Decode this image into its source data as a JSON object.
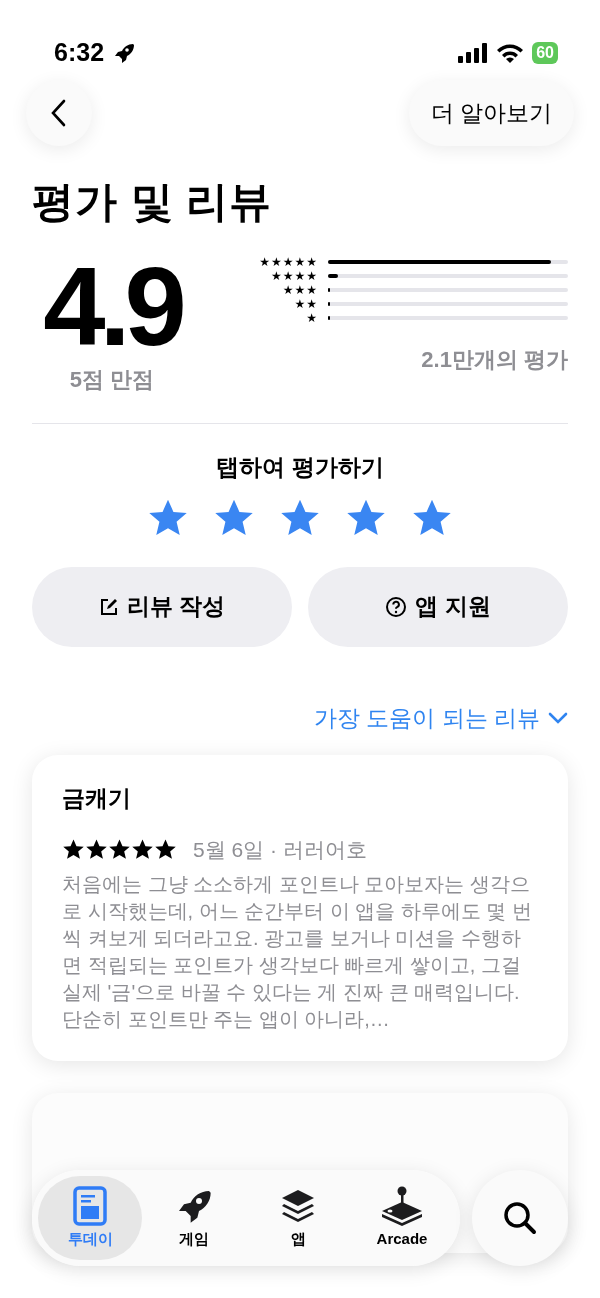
{
  "status_bar": {
    "time": "6:32",
    "battery": "60"
  },
  "header": {
    "more_button": "더 알아보기"
  },
  "title": "평가 및 리뷰",
  "summary": {
    "score": "4.9",
    "out_of": "5점 만점",
    "count": "2.1만개의 평가",
    "histogram": [
      {
        "label": "★★★★★",
        "level": 0.93
      },
      {
        "label": "★★★★",
        "level": 0.04
      },
      {
        "label": "★★★",
        "level": 0.01
      },
      {
        "label": "★★",
        "level": 0.005
      },
      {
        "label": "★",
        "level": 0.005
      }
    ]
  },
  "tap_to_rate": {
    "label": "탭하여 평가하기",
    "stars": 5
  },
  "actions": [
    {
      "label": "리뷰 작성",
      "kind": "write"
    },
    {
      "label": "앱 지원",
      "kind": "support"
    }
  ],
  "sort": {
    "label": "가장 도움이 되는 리뷰"
  },
  "reviews": [
    {
      "title": "금캐기",
      "stars": 5,
      "meta": "5월 6일 · 러러어호",
      "body": "처음에는 그냥 소소하게 포인트나 모아보자는 생각으로 시작했는데, 어느 순간부터 이 앱을 하루에도 몇 번씩 켜보게 되더라고요. 광고를 보거나 미션을 수행하면 적립되는 포인트가 생각보다 빠르게 쌓이고, 그걸 실제 '금'으로 바꿀 수 있다는 게 진짜 큰 매력입니다. 단순히 포인트만 주는 앱이 아니라,…"
    }
  ],
  "tab_bar": {
    "items": [
      {
        "label": "투데이",
        "kind": "today",
        "selected": true
      },
      {
        "label": "게임",
        "kind": "games",
        "selected": false
      },
      {
        "label": "앱",
        "kind": "apps",
        "selected": false
      },
      {
        "label": "Arcade",
        "kind": "arcade",
        "selected": false
      }
    ]
  }
}
